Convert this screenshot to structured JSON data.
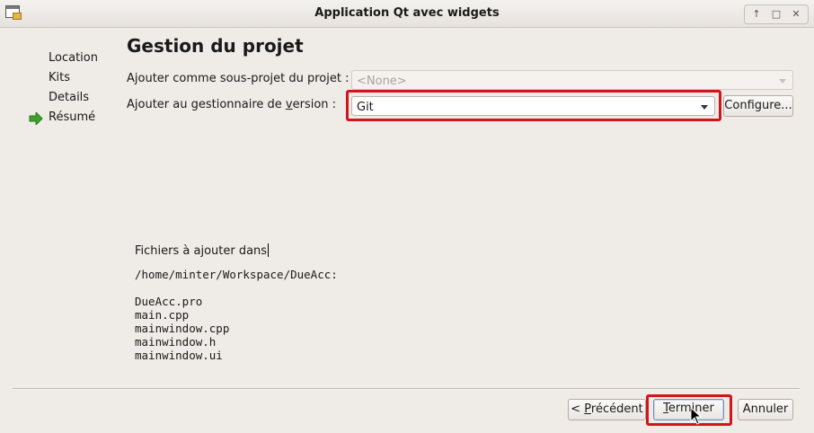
{
  "window": {
    "title": "Application Qt avec widgets",
    "controls": [
      "↑",
      "□",
      "✕"
    ]
  },
  "steps": {
    "items": [
      "Location",
      "Kits",
      "Details",
      "Résumé"
    ],
    "current_index": 3
  },
  "page": {
    "title": "Gestion du projet",
    "subproject_label": "Ajouter comme sous-projet du projet :",
    "subproject_value": "<None>",
    "vcs_label_pre": "Ajouter au gestionnaire de ",
    "vcs_label_mnemonic": "v",
    "vcs_label_post": "ersion :",
    "vcs_value": "Git",
    "configure_label": "Configure..."
  },
  "summary": {
    "heading": "Fichiers à ajouter dans",
    "path": "/home/minter/Workspace/DueAcc:",
    "files": [
      "DueAcc.pro",
      "main.cpp",
      "mainwindow.cpp",
      "mainwindow.h",
      "mainwindow.ui"
    ]
  },
  "footer": {
    "back_pre": "< ",
    "back_mnemonic": "P",
    "back_post": "récédent",
    "finish_mnemonic": "T",
    "finish_post": "erminer",
    "cancel_label": "Annuler"
  },
  "colors": {
    "highlight": "#d0161c",
    "step_arrow": "#3fa02c"
  }
}
